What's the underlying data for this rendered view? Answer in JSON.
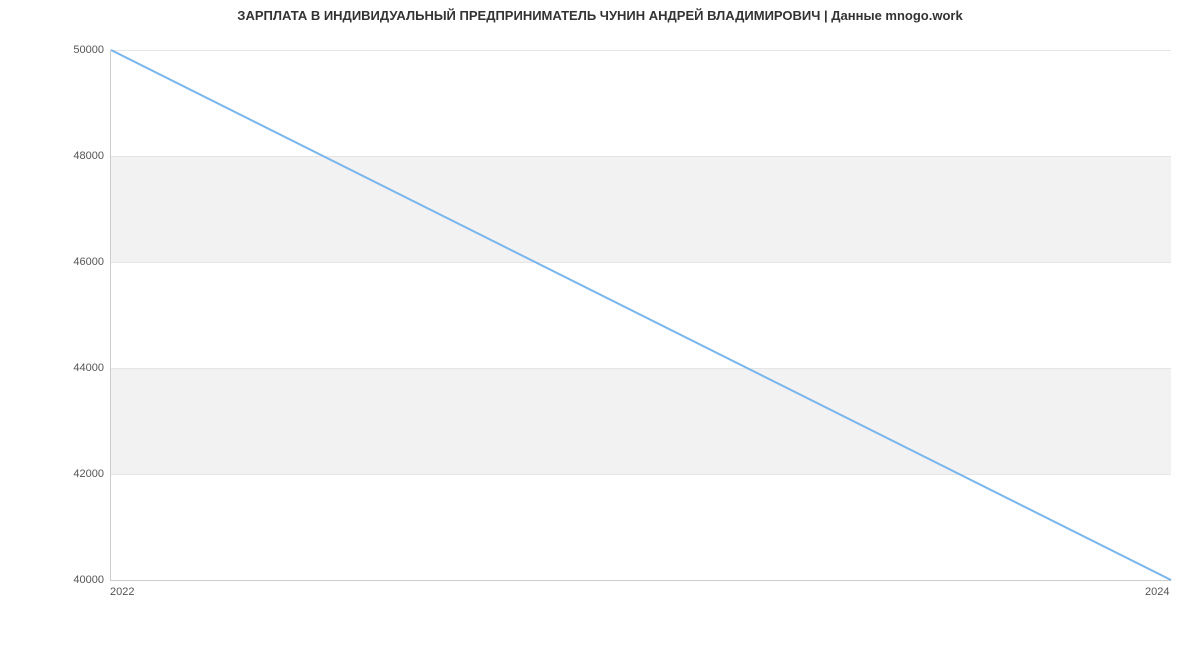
{
  "title": "ЗАРПЛАТА В ИНДИВИДУАЛЬНЫЙ ПРЕДПРИНИМАТЕЛЬ ЧУНИН АНДРЕЙ ВЛАДИМИРОВИЧ | Данные mnogo.work",
  "chart_data": {
    "type": "line",
    "x": [
      2022,
      2024
    ],
    "values": [
      50000,
      40000
    ],
    "title": "ЗАРПЛАТА В ИНДИВИДУАЛЬНЫЙ ПРЕДПРИНИМАТЕЛЬ ЧУНИН АНДРЕЙ ВЛАДИМИРОВИЧ | Данные mnogo.work",
    "xlabel": "",
    "ylabel": "",
    "ylim": [
      40000,
      50000
    ],
    "xlim": [
      2022,
      2024
    ],
    "y_ticks": [
      40000,
      42000,
      44000,
      46000,
      48000,
      50000
    ],
    "x_ticks": [
      2022,
      2024
    ],
    "y_tick_labels": [
      "40000",
      "42000",
      "44000",
      "46000",
      "48000",
      "50000"
    ],
    "x_tick_labels": [
      "2022",
      "2024"
    ],
    "line_color": "#7cb5ec"
  }
}
